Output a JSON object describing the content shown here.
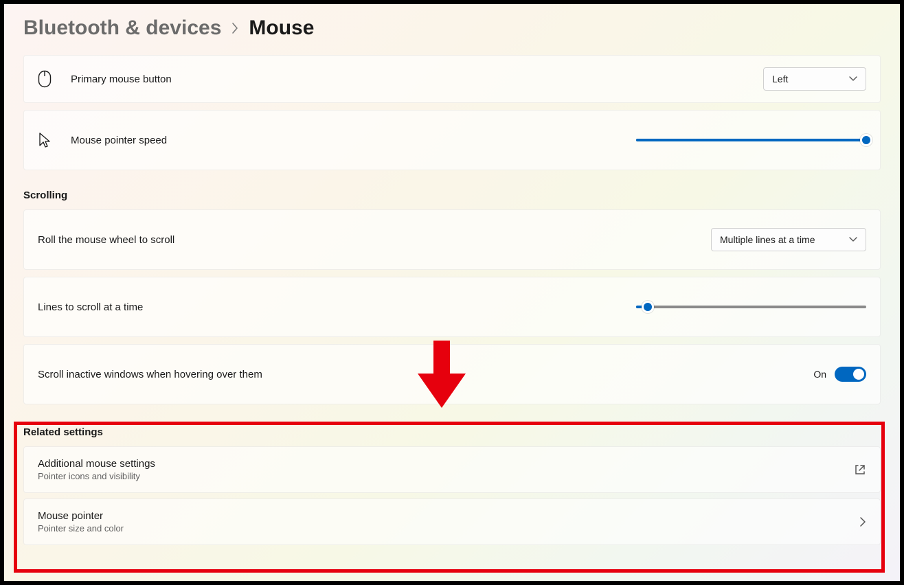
{
  "breadcrumb": {
    "parent": "Bluetooth & devices",
    "current": "Mouse"
  },
  "primary_button": {
    "label": "Primary mouse button",
    "value": "Left"
  },
  "pointer_speed": {
    "label": "Mouse pointer speed",
    "value_percent": 100
  },
  "sections": {
    "scrolling_title": "Scrolling",
    "related_title": "Related settings"
  },
  "scroll_mode": {
    "label": "Roll the mouse wheel to scroll",
    "value": "Multiple lines at a time"
  },
  "scroll_lines": {
    "label": "Lines to scroll at a time",
    "value_percent": 5
  },
  "scroll_inactive": {
    "label": "Scroll inactive windows when hovering over them",
    "state_label": "On",
    "enabled": true
  },
  "related": {
    "additional": {
      "title": "Additional mouse settings",
      "sub": "Pointer icons and visibility"
    },
    "pointer": {
      "title": "Mouse pointer",
      "sub": "Pointer size and color"
    }
  },
  "colors": {
    "accent": "#0067c0",
    "annotation": "#e6000d"
  }
}
